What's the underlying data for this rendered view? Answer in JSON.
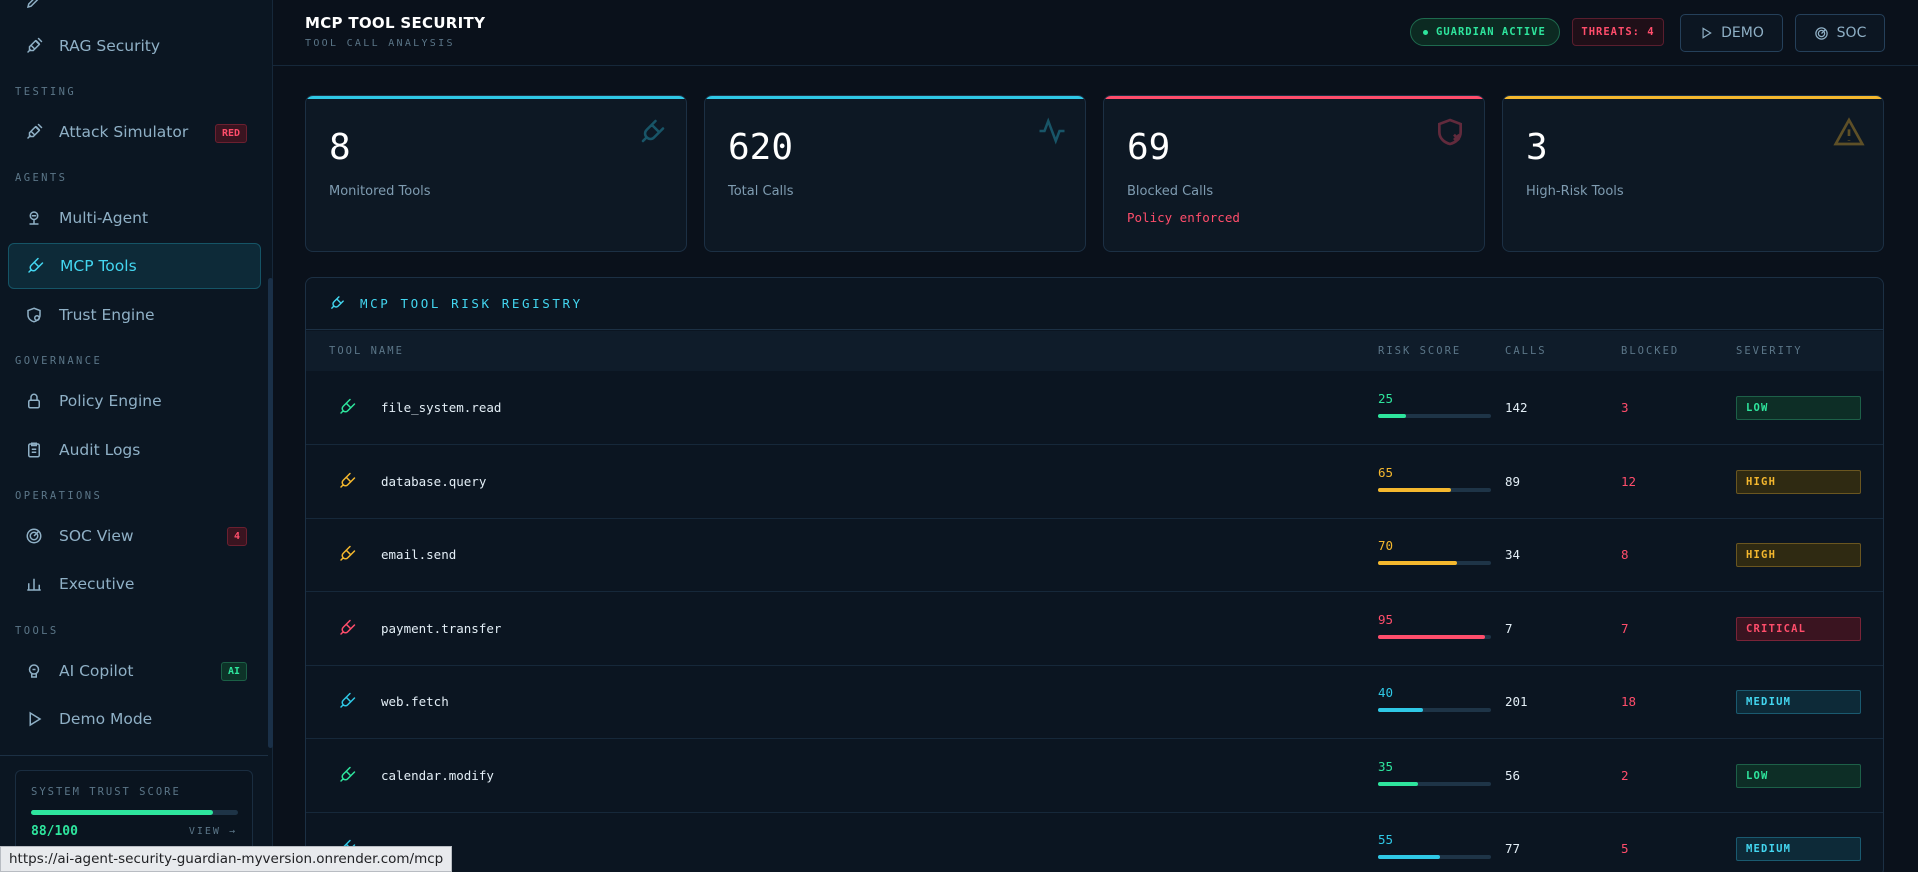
{
  "sidebar": {
    "sections": {
      "testing": "TESTING",
      "agents": "AGENTS",
      "governance": "GOVERNANCE",
      "operations": "OPERATIONS",
      "tools": "TOOLS"
    },
    "items": {
      "rag_security": "RAG Security",
      "attack_simulator": "Attack Simulator",
      "attack_badge": "RED",
      "multi_agent": "Multi-Agent",
      "mcp_tools": "MCP Tools",
      "trust_engine": "Trust Engine",
      "policy_engine": "Policy Engine",
      "audit_logs": "Audit Logs",
      "soc_view": "SOC View",
      "soc_badge": "4",
      "executive": "Executive",
      "ai_copilot": "AI Copilot",
      "ai_badge": "AI",
      "demo_mode": "Demo Mode"
    },
    "trust": {
      "label": "SYSTEM TRUST SCORE",
      "score": "88/100",
      "value": 88,
      "view": "VIEW →"
    }
  },
  "header": {
    "title": "MCP TOOL SECURITY",
    "subtitle": "TOOL CALL ANALYSIS",
    "guardian": "GUARDIAN ACTIVE",
    "threats": "THREATS: 4",
    "demo": "DEMO",
    "soc": "SOC"
  },
  "stats": [
    {
      "value": "8",
      "label": "Monitored Tools",
      "accent": "#2fc8e6",
      "icon": "plug-icon"
    },
    {
      "value": "620",
      "label": "Total Calls",
      "accent": "#2fc8e6",
      "icon": "activity-icon"
    },
    {
      "value": "69",
      "label": "Blocked Calls",
      "note": "Policy enforced",
      "accent": "#ff4d6b",
      "icon": "shield-x-icon"
    },
    {
      "value": "3",
      "label": "High-Risk Tools",
      "accent": "#f5b82e",
      "icon": "warning-icon"
    }
  ],
  "registry": {
    "title": "MCP TOOL RISK REGISTRY",
    "columns": {
      "tool": "TOOL NAME",
      "risk": "RISK SCORE",
      "calls": "CALLS",
      "blocked": "BLOCKED",
      "severity": "SEVERITY"
    },
    "rows": [
      {
        "name": "file_system.read",
        "risk": "25",
        "risk_value": 25,
        "calls": "142",
        "blocked": "3",
        "severity": "LOW",
        "color": "#2ee59d"
      },
      {
        "name": "database.query",
        "risk": "65",
        "risk_value": 65,
        "calls": "89",
        "blocked": "12",
        "severity": "HIGH",
        "color": "#f5b82e"
      },
      {
        "name": "email.send",
        "risk": "70",
        "risk_value": 70,
        "calls": "34",
        "blocked": "8",
        "severity": "HIGH",
        "color": "#f5b82e"
      },
      {
        "name": "payment.transfer",
        "risk": "95",
        "risk_value": 95,
        "calls": "7",
        "blocked": "7",
        "severity": "CRITICAL",
        "color": "#ff4d6b"
      },
      {
        "name": "web.fetch",
        "risk": "40",
        "risk_value": 40,
        "calls": "201",
        "blocked": "18",
        "severity": "MEDIUM",
        "color": "#2fc8e6"
      },
      {
        "name": "calendar.modify",
        "risk": "35",
        "risk_value": 35,
        "calls": "56",
        "blocked": "2",
        "severity": "LOW",
        "color": "#2ee59d"
      },
      {
        "name": "",
        "risk": "55",
        "risk_value": 55,
        "calls": "77",
        "blocked": "5",
        "severity": "MEDIUM",
        "color": "#2fc8e6"
      }
    ]
  },
  "status_url": "https://ai-agent-security-guardian-myversion.onrender.com/mcp"
}
